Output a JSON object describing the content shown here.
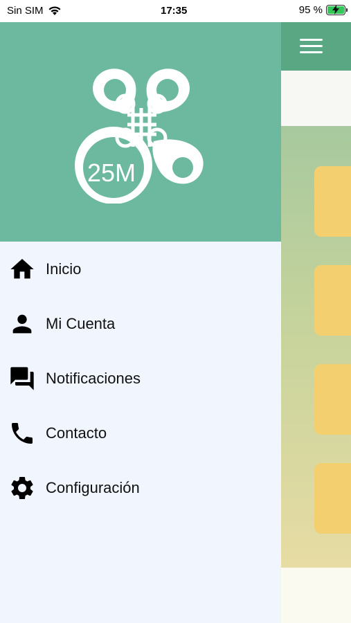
{
  "status_bar": {
    "carrier": "Sin SIM",
    "time": "17:35",
    "battery": "95 %"
  },
  "drawer": {
    "logo_text": "25M",
    "menu": [
      {
        "label": "Inicio",
        "icon": "home-icon"
      },
      {
        "label": "Mi Cuenta",
        "icon": "person-icon"
      },
      {
        "label": "Notificaciones",
        "icon": "chat-icon"
      },
      {
        "label": "Contacto",
        "icon": "phone-icon"
      },
      {
        "label": "Configuración",
        "icon": "gear-icon"
      }
    ]
  },
  "colors": {
    "drawer_header": "#6db9a0",
    "app_header": "#5aa784",
    "drawer_bg": "#f1f5fd",
    "card": "#f4cf70"
  }
}
